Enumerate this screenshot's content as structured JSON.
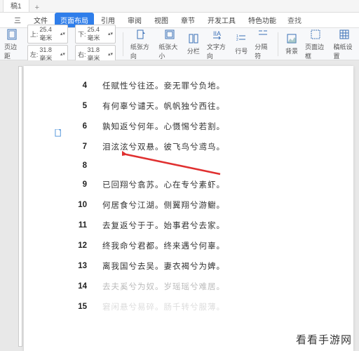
{
  "docTab": "稿1",
  "menu": {
    "items": [
      "三",
      "文件",
      "页面布局",
      "引用",
      "审阅",
      "视图",
      "章节",
      "开发工具",
      "特色功能"
    ],
    "active_index": 2,
    "search": "查找"
  },
  "ribbon": {
    "margins_label": "页边距",
    "top": "25.4 毫米",
    "bottom": "25.4 毫米",
    "left": "31.8 毫米",
    "right": "31.8 毫米",
    "orient": "纸张方向",
    "size": "纸张大小",
    "columns": "分栏",
    "textdir": "文字方向",
    "linenums": "行号",
    "breaks": "分隔符",
    "bg": "背景",
    "border": "页面边框",
    "pgrid": "稿纸设置"
  },
  "lines": [
    {
      "n": "4",
      "t": "任赋性兮往还。妾无罪兮负地。"
    },
    {
      "n": "5",
      "t": "有何辜兮谴天。帆帆独兮西往。"
    },
    {
      "n": "6",
      "t": "孰知返兮何年。心慑惕兮若割。"
    },
    {
      "n": "7",
      "t": "泪泫泫兮双悬。彼飞鸟兮鸢鸟。"
    },
    {
      "n": "8",
      "t": ""
    },
    {
      "n": "9",
      "t": "已回翔兮翕苏。心在专兮素虾。"
    },
    {
      "n": "10",
      "t": "何居食兮江湖。侧翼翔兮游鳚。"
    },
    {
      "n": "11",
      "t": "去复返兮于于。始事君兮去家。"
    },
    {
      "n": "12",
      "t": "终我命兮君都。终来遇兮何辜。"
    },
    {
      "n": "13",
      "t": "离我国兮去吴。妻衣褐兮为婢。"
    },
    {
      "n": "14",
      "t": "去夫奚兮为奴。岁瑶瑶兮难居。"
    },
    {
      "n": "15",
      "t": "窘闲悬兮易碎。肠千转兮服薄。"
    }
  ],
  "watermark": "看看手游网"
}
